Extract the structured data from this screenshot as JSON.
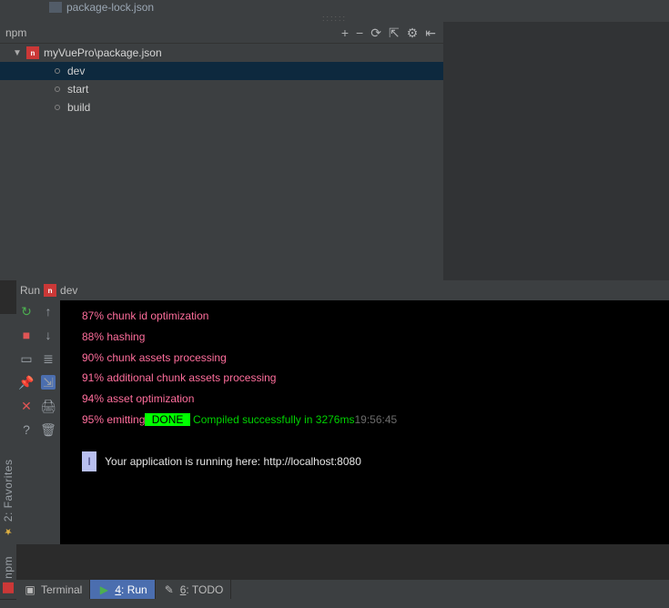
{
  "project_tree_fragment": "package-lock.json",
  "npm_panel": {
    "title": "npm",
    "toolbar_icons": {
      "add": "+",
      "remove": "−",
      "refresh": "⟳",
      "run": "⇱",
      "settings": "⚙",
      "move": "⇤"
    },
    "root_label": "myVuePro\\package.json",
    "scripts": [
      "dev",
      "start",
      "build"
    ],
    "selected_index": 0
  },
  "run_panel": {
    "title_prefix": "Run",
    "config_name": "dev",
    "gutter_left": {
      "rerun": "↻",
      "stop": "■",
      "dump": "▭",
      "pin": "📌",
      "close": "✕",
      "help": "?"
    },
    "gutter_right": {
      "up": "↑",
      "down": "↓",
      "wrap": "≣",
      "scroll": "⇲",
      "print": "🖨",
      "trash": "🗑"
    }
  },
  "console": {
    "lines": [
      {
        "style": "pink",
        "text": "87% chunk id optimization"
      },
      {
        "style": "pink",
        "text": "88% hashing"
      },
      {
        "style": "pink",
        "text": "90% chunk assets processing"
      },
      {
        "style": "pink",
        "text": "91% additional chunk assets processing"
      },
      {
        "style": "pink",
        "text": "94% asset optimization"
      }
    ],
    "emit_prefix": "95% emitting",
    "done_text": " DONE ",
    "compiled_text": " Compiled successfully in 3276ms",
    "timestamp": "19:56:45",
    "info_badge": "I",
    "running_line": " Your application is running here: http://localhost:8080"
  },
  "left_stripe": {
    "favorites": "2: Favorites",
    "npm": "npm"
  },
  "bottom_tabs": {
    "terminal": "Terminal",
    "run_num": "4",
    "run_label": ": Run",
    "todo_num": "6",
    "todo_label": ": TODO"
  }
}
